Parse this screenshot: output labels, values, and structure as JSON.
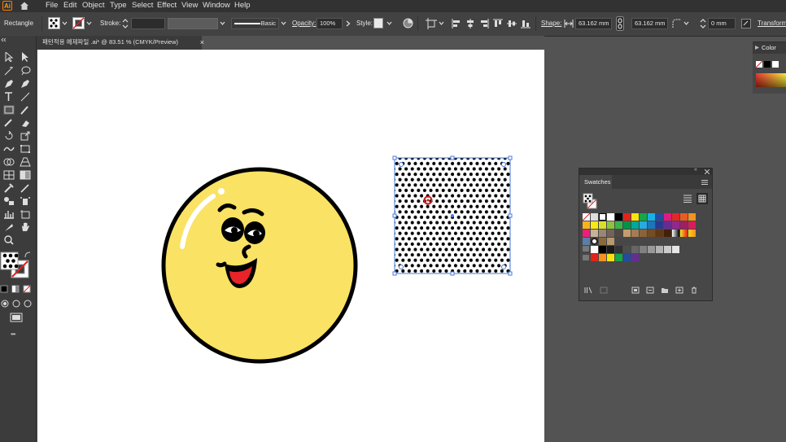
{
  "menubar": {
    "app_logo": "Ai",
    "items": [
      "File",
      "Edit",
      "Object",
      "Type",
      "Select",
      "Effect",
      "View",
      "Window",
      "Help"
    ]
  },
  "controlbar": {
    "tool_name": "Rectangle",
    "stroke_label": "Stroke:",
    "brush_label": "Basic",
    "opacity_label": "Opacity:",
    "opacity_value": "100%",
    "style_label": "Style:",
    "shape_label": "Shape:",
    "width_value": "63.162 mm",
    "height_value": "63.162 mm",
    "corner_value": "0 mm",
    "transform_label": "Transform"
  },
  "document": {
    "tab_title": "패턴적용 예제파일 .ai* @ 83.51 % (CMYK/Preview)",
    "close_glyph": "×"
  },
  "color_panel": {
    "title": "Color"
  },
  "swatches_panel": {
    "title": "Swatches"
  },
  "toolbar": {
    "more_glyph": "•••"
  },
  "colors": {
    "accent_selection": "#4a7bd9",
    "face_fill": "#fae264",
    "outline": "#000000",
    "mouth_red": "#e8232a"
  }
}
